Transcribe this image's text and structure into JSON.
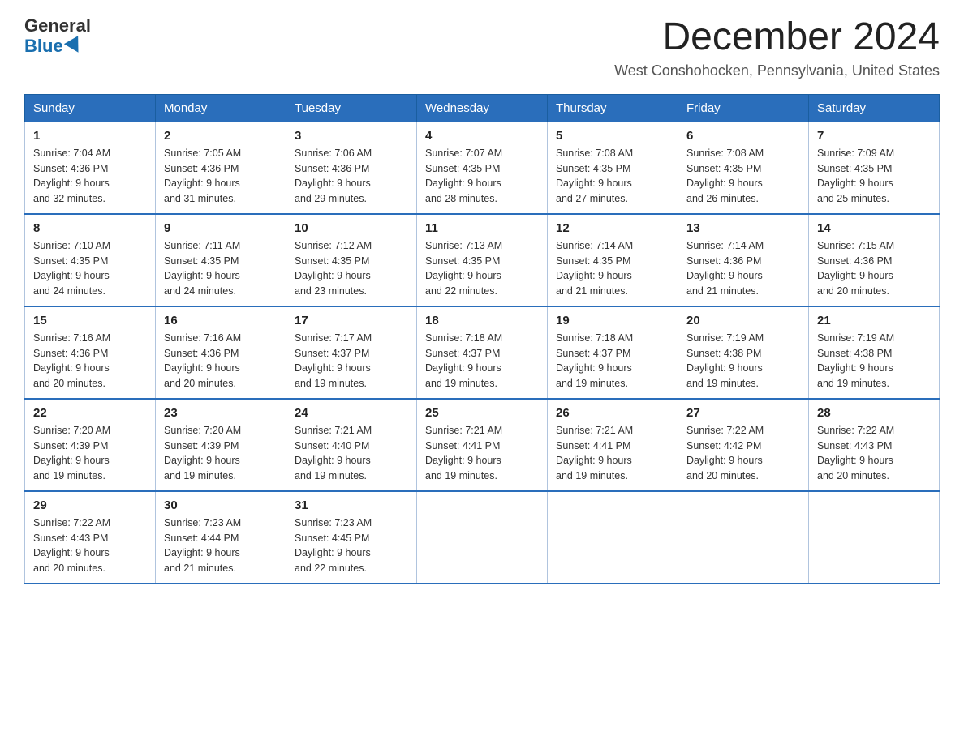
{
  "header": {
    "logo_general": "General",
    "logo_blue": "Blue",
    "month_title": "December 2024",
    "location": "West Conshohocken, Pennsylvania, United States"
  },
  "days_of_week": [
    "Sunday",
    "Monday",
    "Tuesday",
    "Wednesday",
    "Thursday",
    "Friday",
    "Saturday"
  ],
  "weeks": [
    [
      {
        "day": "1",
        "sunrise": "7:04 AM",
        "sunset": "4:36 PM",
        "daylight": "9 hours and 32 minutes."
      },
      {
        "day": "2",
        "sunrise": "7:05 AM",
        "sunset": "4:36 PM",
        "daylight": "9 hours and 31 minutes."
      },
      {
        "day": "3",
        "sunrise": "7:06 AM",
        "sunset": "4:36 PM",
        "daylight": "9 hours and 29 minutes."
      },
      {
        "day": "4",
        "sunrise": "7:07 AM",
        "sunset": "4:35 PM",
        "daylight": "9 hours and 28 minutes."
      },
      {
        "day": "5",
        "sunrise": "7:08 AM",
        "sunset": "4:35 PM",
        "daylight": "9 hours and 27 minutes."
      },
      {
        "day": "6",
        "sunrise": "7:08 AM",
        "sunset": "4:35 PM",
        "daylight": "9 hours and 26 minutes."
      },
      {
        "day": "7",
        "sunrise": "7:09 AM",
        "sunset": "4:35 PM",
        "daylight": "9 hours and 25 minutes."
      }
    ],
    [
      {
        "day": "8",
        "sunrise": "7:10 AM",
        "sunset": "4:35 PM",
        "daylight": "9 hours and 24 minutes."
      },
      {
        "day": "9",
        "sunrise": "7:11 AM",
        "sunset": "4:35 PM",
        "daylight": "9 hours and 24 minutes."
      },
      {
        "day": "10",
        "sunrise": "7:12 AM",
        "sunset": "4:35 PM",
        "daylight": "9 hours and 23 minutes."
      },
      {
        "day": "11",
        "sunrise": "7:13 AM",
        "sunset": "4:35 PM",
        "daylight": "9 hours and 22 minutes."
      },
      {
        "day": "12",
        "sunrise": "7:14 AM",
        "sunset": "4:35 PM",
        "daylight": "9 hours and 21 minutes."
      },
      {
        "day": "13",
        "sunrise": "7:14 AM",
        "sunset": "4:36 PM",
        "daylight": "9 hours and 21 minutes."
      },
      {
        "day": "14",
        "sunrise": "7:15 AM",
        "sunset": "4:36 PM",
        "daylight": "9 hours and 20 minutes."
      }
    ],
    [
      {
        "day": "15",
        "sunrise": "7:16 AM",
        "sunset": "4:36 PM",
        "daylight": "9 hours and 20 minutes."
      },
      {
        "day": "16",
        "sunrise": "7:16 AM",
        "sunset": "4:36 PM",
        "daylight": "9 hours and 20 minutes."
      },
      {
        "day": "17",
        "sunrise": "7:17 AM",
        "sunset": "4:37 PM",
        "daylight": "9 hours and 19 minutes."
      },
      {
        "day": "18",
        "sunrise": "7:18 AM",
        "sunset": "4:37 PM",
        "daylight": "9 hours and 19 minutes."
      },
      {
        "day": "19",
        "sunrise": "7:18 AM",
        "sunset": "4:37 PM",
        "daylight": "9 hours and 19 minutes."
      },
      {
        "day": "20",
        "sunrise": "7:19 AM",
        "sunset": "4:38 PM",
        "daylight": "9 hours and 19 minutes."
      },
      {
        "day": "21",
        "sunrise": "7:19 AM",
        "sunset": "4:38 PM",
        "daylight": "9 hours and 19 minutes."
      }
    ],
    [
      {
        "day": "22",
        "sunrise": "7:20 AM",
        "sunset": "4:39 PM",
        "daylight": "9 hours and 19 minutes."
      },
      {
        "day": "23",
        "sunrise": "7:20 AM",
        "sunset": "4:39 PM",
        "daylight": "9 hours and 19 minutes."
      },
      {
        "day": "24",
        "sunrise": "7:21 AM",
        "sunset": "4:40 PM",
        "daylight": "9 hours and 19 minutes."
      },
      {
        "day": "25",
        "sunrise": "7:21 AM",
        "sunset": "4:41 PM",
        "daylight": "9 hours and 19 minutes."
      },
      {
        "day": "26",
        "sunrise": "7:21 AM",
        "sunset": "4:41 PM",
        "daylight": "9 hours and 19 minutes."
      },
      {
        "day": "27",
        "sunrise": "7:22 AM",
        "sunset": "4:42 PM",
        "daylight": "9 hours and 20 minutes."
      },
      {
        "day": "28",
        "sunrise": "7:22 AM",
        "sunset": "4:43 PM",
        "daylight": "9 hours and 20 minutes."
      }
    ],
    [
      {
        "day": "29",
        "sunrise": "7:22 AM",
        "sunset": "4:43 PM",
        "daylight": "9 hours and 20 minutes."
      },
      {
        "day": "30",
        "sunrise": "7:23 AM",
        "sunset": "4:44 PM",
        "daylight": "9 hours and 21 minutes."
      },
      {
        "day": "31",
        "sunrise": "7:23 AM",
        "sunset": "4:45 PM",
        "daylight": "9 hours and 22 minutes."
      },
      null,
      null,
      null,
      null
    ]
  ],
  "labels": {
    "sunrise_prefix": "Sunrise: ",
    "sunset_prefix": "Sunset: ",
    "daylight_prefix": "Daylight: "
  }
}
